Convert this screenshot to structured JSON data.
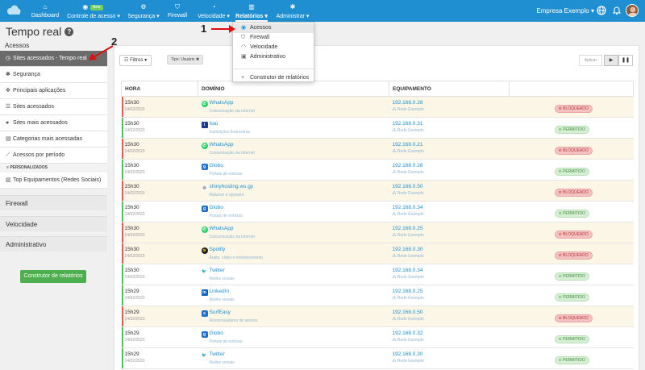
{
  "nav": {
    "items": [
      {
        "label": "Dashboard",
        "icon": "home-icon"
      },
      {
        "label": "Controle de acesso",
        "icon": "globe-icon",
        "badge": "New"
      },
      {
        "label": "Segurança",
        "icon": "gears-icon"
      },
      {
        "label": "Firewall",
        "icon": "shield-icon"
      },
      {
        "label": "Velocidade",
        "icon": "gauge-icon"
      },
      {
        "label": "Relatórios",
        "icon": "chart-icon"
      },
      {
        "label": "Administrar",
        "icon": "gear-icon"
      }
    ],
    "company": "Empresa Exemplo"
  },
  "page": {
    "title": "Tempo real"
  },
  "sidebar": {
    "section": "Acessos",
    "items": [
      {
        "label": "Sites acessados - Tempo real",
        "icon": "clock-icon"
      },
      {
        "label": "Segurança",
        "icon": "gears-icon"
      },
      {
        "label": "Principais aplicações",
        "icon": "apps-icon"
      },
      {
        "label": "Sites acessados",
        "icon": "list-icon"
      },
      {
        "label": "Sites mais acessados",
        "icon": "globe-icon"
      },
      {
        "label": "Categorias mais acessadas",
        "icon": "folder-icon"
      },
      {
        "label": "Acessos por período",
        "icon": "line-chart-icon"
      }
    ],
    "personalized_header": "PERSONALIZADOS",
    "personalized": [
      {
        "label": "Top Equipamentos (Redes Sociais)",
        "icon": "chart-icon"
      }
    ],
    "groups": [
      "Firewall",
      "Velocidade",
      "Administrativo"
    ],
    "create_button": "Construtor de relatórios"
  },
  "toolbar": {
    "filters": "Filtros",
    "tag": "Tipo: Usuário",
    "apply": "Aplicar"
  },
  "table": {
    "headers": [
      "HORA",
      "DOMÍNIO",
      "EQUIPAMENTO",
      ""
    ],
    "rows": [
      {
        "time": "15h30",
        "date": "14/02/2023",
        "domain": "WhatsApp",
        "category": "Comunicação via internet",
        "icon": "whatsapp-icon",
        "ip": "192.168.0.28",
        "network": "Rede Exemplo",
        "status": "BLOQUEADO",
        "blocked": true
      },
      {
        "time": "15h30",
        "date": "14/02/2023",
        "domain": "Itaú",
        "category": "Instituições financeiras",
        "icon": "itau-icon",
        "ip": "192.168.0.31",
        "network": "Rede Exemplo",
        "status": "PERMITIDO",
        "blocked": false
      },
      {
        "time": "15h30",
        "date": "14/02/2023",
        "domain": "WhatsApp",
        "category": "Comunicação via internet",
        "icon": "whatsapp-icon",
        "ip": "192.168.0.21",
        "network": "Rede Exemplo",
        "status": "BLOQUEADO",
        "blocked": true
      },
      {
        "time": "15h30",
        "date": "14/02/2023",
        "domain": "Globo",
        "category": "Portais de notícias",
        "icon": "globo-icon",
        "ip": "192.168.0.26",
        "network": "Rede Exemplo",
        "status": "PERMITIDO",
        "blocked": false
      },
      {
        "time": "15h30",
        "date": "14/02/2023",
        "domain": "shinyhosting.ws.gy",
        "category": "Malware e spyware",
        "icon": "globe-icon",
        "ip": "192.168.0.50",
        "network": "Rede Exemplo",
        "status": "BLOQUEADO",
        "blocked": true
      },
      {
        "time": "15h30",
        "date": "14/02/2023",
        "domain": "Globo",
        "category": "Portais de notícias",
        "icon": "globo-icon",
        "ip": "192.168.0.34",
        "network": "Rede Exemplo",
        "status": "PERMITIDO",
        "blocked": false
      },
      {
        "time": "15h30",
        "date": "14/02/2023",
        "domain": "WhatsApp",
        "category": "Comunicação via internet",
        "icon": "whatsapp-icon",
        "ip": "192.168.0.25",
        "network": "Rede Exemplo",
        "status": "BLOQUEADO",
        "blocked": true
      },
      {
        "time": "15h30",
        "date": "14/02/2023",
        "domain": "Spotify",
        "category": "Áudio, vídeo e entretenimento",
        "icon": "spotify-icon",
        "ip": "192.168.0.30",
        "network": "Rede Exemplo",
        "status": "BLOQUEADO",
        "blocked": true
      },
      {
        "time": "15h30",
        "date": "14/02/2023",
        "domain": "Twitter",
        "category": "Redes sociais",
        "icon": "twitter-icon",
        "ip": "192.168.0.34",
        "network": "Rede Exemplo",
        "status": "PERMITIDO",
        "blocked": false
      },
      {
        "time": "15h29",
        "date": "14/02/2023",
        "domain": "LinkedIn",
        "category": "Redes sociais",
        "icon": "linkedin-icon",
        "ip": "192.168.0.25",
        "network": "Rede Exemplo",
        "status": "PERMITIDO",
        "blocked": false
      },
      {
        "time": "15h29",
        "date": "14/02/2023",
        "domain": "SurfEasy",
        "category": "Anonimizadores de acesso",
        "icon": "surfeasy-icon",
        "ip": "192.168.0.50",
        "network": "Rede Exemplo",
        "status": "BLOQUEADO",
        "blocked": true
      },
      {
        "time": "15h29",
        "date": "14/02/2023",
        "domain": "Globo",
        "category": "Portais de notícias",
        "icon": "globo-icon",
        "ip": "192.168.0.32",
        "network": "Rede Exemplo",
        "status": "PERMITIDO",
        "blocked": false
      },
      {
        "time": "15h29",
        "date": "14/02/2023",
        "domain": "Twitter",
        "category": "Redes sociais",
        "icon": "twitter-icon",
        "ip": "192.168.0.30",
        "network": "Rede Exemplo",
        "status": "PERMITIDO",
        "blocked": false
      }
    ]
  },
  "dropdown": {
    "items": [
      {
        "label": "Acessos",
        "icon": "globe-icon"
      },
      {
        "label": "Firewall",
        "icon": "shield-icon"
      },
      {
        "label": "Velocidade",
        "icon": "gauge-icon"
      },
      {
        "label": "Administrativo",
        "icon": "briefcase-icon"
      }
    ],
    "footer": "Construtor de relatórios"
  },
  "annotations": {
    "one": "1",
    "two": "2"
  },
  "colors": {
    "brand": "#1f8fd1",
    "blocked": "#e05a5a",
    "allowed": "#5cb85c",
    "create": "#4cae4c"
  }
}
